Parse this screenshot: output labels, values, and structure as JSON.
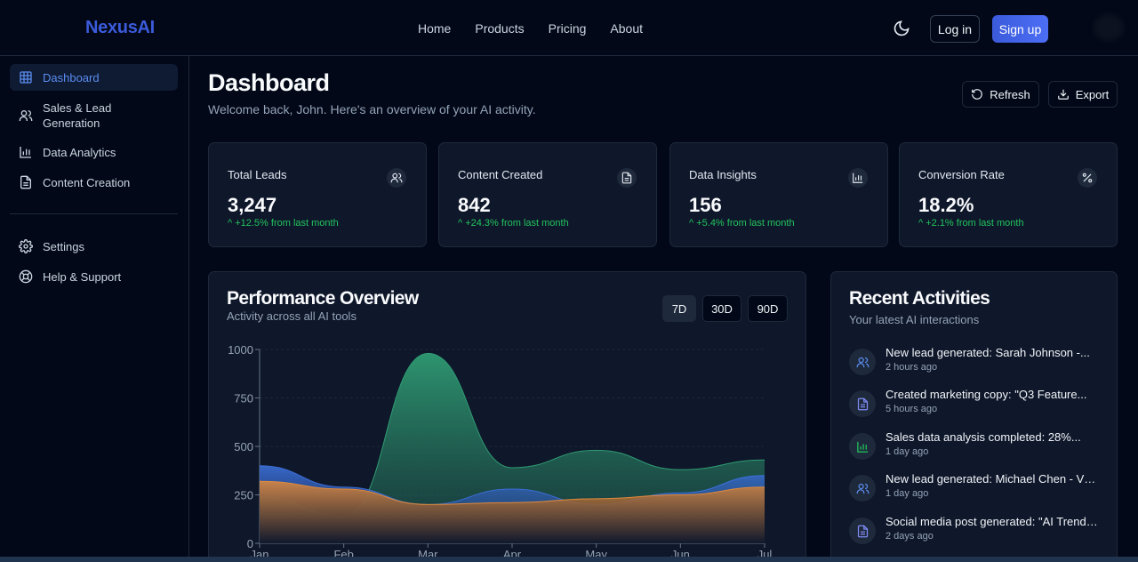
{
  "header": {
    "logo": "NexusAI",
    "nav": [
      "Home",
      "Products",
      "Pricing",
      "About"
    ],
    "login_label": "Log in",
    "signup_label": "Sign up"
  },
  "sidebar": {
    "items": [
      {
        "label": "Dashboard",
        "icon": "grid-icon"
      },
      {
        "label": "Sales & Lead Generation",
        "icon": "users-icon"
      },
      {
        "label": "Data Analytics",
        "icon": "bar-chart-icon"
      },
      {
        "label": "Content Creation",
        "icon": "file-text-icon"
      }
    ],
    "footer_items": [
      {
        "label": "Settings",
        "icon": "gear-icon"
      },
      {
        "label": "Help & Support",
        "icon": "lifebuoy-icon"
      }
    ]
  },
  "page": {
    "title": "Dashboard",
    "subtitle": "Welcome back, John. Here's an overview of your AI activity.",
    "refresh_label": "Refresh",
    "export_label": "Export"
  },
  "stats": [
    {
      "label": "Total Leads",
      "value": "3,247",
      "change": "+12.5% from last month",
      "icon": "users-icon"
    },
    {
      "label": "Content Created",
      "value": "842",
      "change": "+24.3% from last month",
      "icon": "file-text-icon"
    },
    {
      "label": "Data Insights",
      "value": "156",
      "change": "+5.4% from last month",
      "icon": "bar-chart-icon"
    },
    {
      "label": "Conversion Rate",
      "value": "18.2%",
      "change": "+2.1% from last month",
      "icon": "percent-icon"
    }
  ],
  "performance": {
    "title": "Performance Overview",
    "subtitle": "Activity across all AI tools",
    "ranges": [
      "7D",
      "30D",
      "90D"
    ],
    "selected_range": "7D"
  },
  "chart_data": {
    "type": "area",
    "x": [
      "Jan",
      "Feb",
      "Mar",
      "Apr",
      "May",
      "Jun",
      "Jul"
    ],
    "ylim": [
      0,
      1000
    ],
    "yticks": [
      0,
      250,
      500,
      750,
      1000
    ],
    "grid": true,
    "series": [
      {
        "color": "#2f9b73",
        "values": [
          240,
          140,
          980,
          390,
          480,
          380,
          430
        ]
      },
      {
        "color": "#3b6fd8",
        "values": [
          400,
          290,
          200,
          280,
          200,
          260,
          350
        ]
      },
      {
        "color": "#e08a3c",
        "values": [
          320,
          280,
          200,
          210,
          230,
          250,
          290
        ]
      }
    ]
  },
  "activities": {
    "title": "Recent Activities",
    "subtitle": "Your latest AI interactions",
    "items": [
      {
        "text": "New lead generated: Sarah Johnson -...",
        "time": "2 hours ago",
        "icon": "users-icon",
        "color": "#5b8def"
      },
      {
        "text": "Created marketing copy: \"Q3 Feature...",
        "time": "5 hours ago",
        "icon": "file-text-icon",
        "color": "#818cf8"
      },
      {
        "text": "Sales data analysis completed: 28%...",
        "time": "1 day ago",
        "icon": "bar-chart-icon",
        "color": "#22c55e"
      },
      {
        "text": "New lead generated: Michael Chen - VP...",
        "time": "1 day ago",
        "icon": "users-icon",
        "color": "#5b8def"
      },
      {
        "text": "Social media post generated: \"AI Trends...",
        "time": "2 days ago",
        "icon": "file-text-icon",
        "color": "#818cf8"
      }
    ]
  }
}
